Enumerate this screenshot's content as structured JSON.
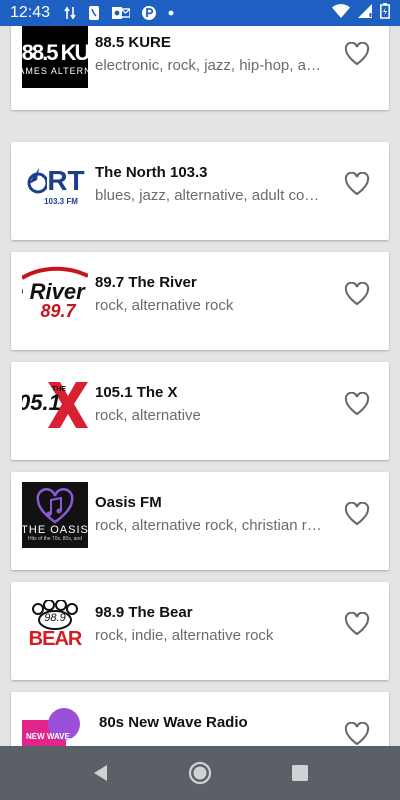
{
  "status_bar": {
    "time": "12:43",
    "icons": [
      "data-transfer-icon",
      "phone-icon",
      "outlook-icon",
      "p-icon",
      "dot-icon",
      "wifi-icon",
      "cellular-signal-icon",
      "battery-icon"
    ]
  },
  "stations": [
    {
      "name": "88.5 KURE",
      "genres": "electronic, rock, jazz, hip-hop, alternative",
      "logo": "kure-logo"
    },
    {
      "name": "The North 103.3",
      "genres": "blues, jazz, alternative, adult contemporary",
      "logo": "the-north-logo"
    },
    {
      "name": "89.7 The River",
      "genres": "rock, alternative rock",
      "logo": "the-river-logo"
    },
    {
      "name": "105.1 The X",
      "genres": "rock, alternative",
      "logo": "the-x-logo"
    },
    {
      "name": "Oasis FM",
      "genres": "rock, alternative rock, christian rock",
      "logo": "oasis-fm-logo"
    },
    {
      "name": "98.9 The Bear",
      "genres": "rock, indie, alternative rock",
      "logo": "the-bear-logo"
    },
    {
      "name": "80s New Wave Radio",
      "genres": "",
      "logo": "new-wave-logo"
    }
  ],
  "logo_text": {
    "kure_main": "88.5 KU",
    "kure_sub": "AMES  ALTERN",
    "north_main": "RT",
    "north_sub": "103.3 FM",
    "river_main": "e River",
    "river_num": "89.7",
    "x_num": "05.1",
    "x_the": "THE",
    "oasis_main": "THE OASIS",
    "oasis_sub": "Hits of the 70s, 80s, and",
    "bear_num": "98.9",
    "bear_main": "BEAR",
    "newwave_main": "NEW WAVE"
  },
  "colors": {
    "status_bar": "#1e5fc2",
    "nav_bar": "#5b6066",
    "background": "#e4e4e4",
    "heart": "#666666"
  },
  "nav_bar": {
    "buttons": [
      "back-button",
      "home-button",
      "recents-button"
    ]
  }
}
